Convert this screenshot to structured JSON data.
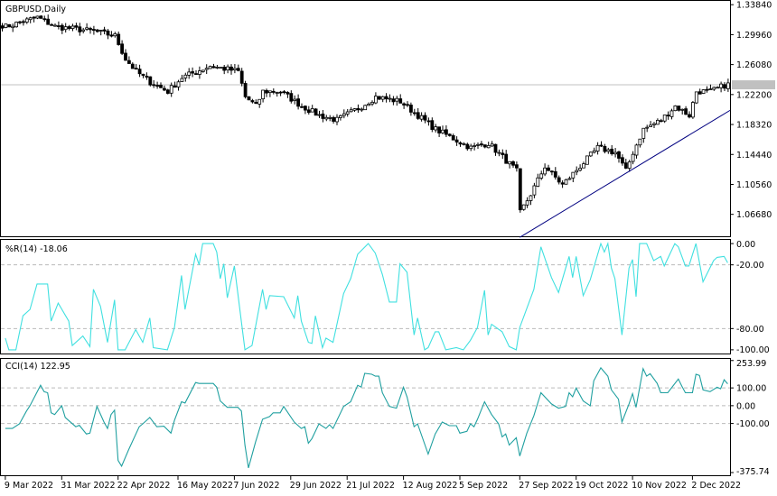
{
  "chart_data": [
    {
      "type": "candlestick",
      "title": "GBPUSD,Daily",
      "bar_count": 207,
      "y_ticks": [
        "1.33840",
        "1.29960",
        "1.26080",
        "1.22200",
        "1.18320",
        "1.14440",
        "1.10560",
        "1.06680"
      ],
      "ylim": [
        1.0384,
        1.3433
      ],
      "current_price_line": 1.2346,
      "close_anchors": [
        [
          0,
          1.312
        ],
        [
          1,
          1.31
        ],
        [
          10,
          1.322
        ],
        [
          15,
          1.31
        ],
        [
          26,
          1.304
        ],
        [
          32,
          1.298
        ],
        [
          35,
          1.268
        ],
        [
          38,
          1.252
        ],
        [
          42,
          1.238
        ],
        [
          47,
          1.226
        ],
        [
          51,
          1.244
        ],
        [
          59,
          1.259
        ],
        [
          67,
          1.252
        ],
        [
          69,
          1.219
        ],
        [
          72,
          1.207
        ],
        [
          74,
          1.226
        ],
        [
          79,
          1.226
        ],
        [
          85,
          1.207
        ],
        [
          90,
          1.195
        ],
        [
          95,
          1.189
        ],
        [
          101,
          1.204
        ],
        [
          106,
          1.219
        ],
        [
          113,
          1.213
        ],
        [
          118,
          1.195
        ],
        [
          123,
          1.177
        ],
        [
          128,
          1.165
        ],
        [
          133,
          1.153
        ],
        [
          138,
          1.159
        ],
        [
          142,
          1.141
        ],
        [
          146,
          1.123
        ],
        [
          147,
          1.069
        ],
        [
          150,
          1.093
        ],
        [
          154,
          1.129
        ],
        [
          159,
          1.105
        ],
        [
          164,
          1.129
        ],
        [
          169,
          1.153
        ],
        [
          174,
          1.147
        ],
        [
          177,
          1.123
        ],
        [
          179,
          1.147
        ],
        [
          182,
          1.177
        ],
        [
          187,
          1.189
        ],
        [
          191,
          1.207
        ],
        [
          195,
          1.195
        ],
        [
          197,
          1.226
        ],
        [
          201,
          1.226
        ],
        [
          205,
          1.234
        ],
        [
          206,
          1.235
        ]
      ],
      "trendline": [
        [
          147,
          1.037
        ],
        [
          207,
          1.2015
        ]
      ],
      "colors": {
        "candle": "#000000",
        "trendline": "#000080",
        "price_line": "#c0c0c0"
      }
    },
    {
      "type": "line",
      "title": "%R(14) -18.06",
      "ylim": [
        -100,
        0
      ],
      "y_ticks": [
        "0.00",
        "-20.00",
        "-80.00",
        "-100.00"
      ],
      "levels": [
        -20,
        -80
      ],
      "color": "#40e0e0",
      "points": [
        [
          1,
          -89
        ],
        [
          2,
          -100
        ],
        [
          4,
          -100
        ],
        [
          6,
          -68
        ],
        [
          8,
          -62
        ],
        [
          10,
          -38
        ],
        [
          13,
          -38
        ],
        [
          14,
          -73
        ],
        [
          16,
          -56
        ],
        [
          19,
          -73
        ],
        [
          20,
          -96
        ],
        [
          23,
          -87
        ],
        [
          25,
          -97
        ],
        [
          26,
          -43
        ],
        [
          28,
          -59
        ],
        [
          30,
          -93
        ],
        [
          32,
          -53
        ],
        [
          33,
          -100
        ],
        [
          35,
          -100
        ],
        [
          38,
          -81
        ],
        [
          40,
          -93
        ],
        [
          42,
          -70
        ],
        [
          43,
          -98
        ],
        [
          47,
          -100
        ],
        [
          49,
          -79
        ],
        [
          51,
          -30
        ],
        [
          52,
          -62
        ],
        [
          55,
          -10
        ],
        [
          56,
          -20
        ],
        [
          57,
          0
        ],
        [
          60,
          0
        ],
        [
          61,
          -8
        ],
        [
          62,
          -33
        ],
        [
          63,
          -19
        ],
        [
          64,
          -51
        ],
        [
          66,
          -21
        ],
        [
          69,
          -100
        ],
        [
          71,
          -96
        ],
        [
          74,
          -43
        ],
        [
          75,
          -62
        ],
        [
          76,
          -49
        ],
        [
          80,
          -50
        ],
        [
          83,
          -70
        ],
        [
          84,
          -49
        ],
        [
          85,
          -73
        ],
        [
          87,
          -93
        ],
        [
          88,
          -94
        ],
        [
          89,
          -68
        ],
        [
          91,
          -98
        ],
        [
          92,
          -89
        ],
        [
          94,
          -93
        ],
        [
          97,
          -47
        ],
        [
          99,
          -33
        ],
        [
          101,
          -10
        ],
        [
          104,
          0
        ],
        [
          106,
          -9
        ],
        [
          108,
          -29
        ],
        [
          110,
          -55
        ],
        [
          112,
          -55
        ],
        [
          113,
          -19
        ],
        [
          115,
          -27
        ],
        [
          117,
          -86
        ],
        [
          118,
          -70
        ],
        [
          120,
          -100
        ],
        [
          121,
          -98
        ],
        [
          123,
          -83
        ],
        [
          124,
          -83
        ],
        [
          126,
          -100
        ],
        [
          129,
          -98
        ],
        [
          131,
          -100
        ],
        [
          133,
          -91
        ],
        [
          135,
          -79
        ],
        [
          137,
          -44
        ],
        [
          138,
          -86
        ],
        [
          139,
          -76
        ],
        [
          142,
          -83
        ],
        [
          144,
          -97
        ],
        [
          146,
          -100
        ],
        [
          147,
          -79
        ],
        [
          151,
          -43
        ],
        [
          153,
          -3
        ],
        [
          156,
          -32
        ],
        [
          158,
          -46
        ],
        [
          161,
          -12
        ],
        [
          162,
          -32
        ],
        [
          163,
          -12
        ],
        [
          165,
          -49
        ],
        [
          167,
          -34
        ],
        [
          170,
          0
        ],
        [
          171,
          -8
        ],
        [
          172,
          0
        ],
        [
          173,
          -23
        ],
        [
          174,
          -33
        ],
        [
          176,
          -86
        ],
        [
          178,
          -23
        ],
        [
          179,
          -15
        ],
        [
          180,
          -50
        ],
        [
          181,
          0
        ],
        [
          183,
          0
        ],
        [
          185,
          -16
        ],
        [
          187,
          -12
        ],
        [
          188,
          -21
        ],
        [
          191,
          0
        ],
        [
          192,
          -3
        ],
        [
          194,
          -21
        ],
        [
          195,
          -21
        ],
        [
          197,
          0
        ],
        [
          199,
          -36
        ],
        [
          202,
          -16
        ],
        [
          203,
          -13
        ],
        [
          205,
          -12
        ],
        [
          206,
          -18.06
        ]
      ]
    },
    {
      "type": "line",
      "title": "CCI(14) 122.95",
      "ylim": [
        -375.74,
        253.99
      ],
      "y_ticks": [
        "253.99",
        "100.00",
        "0.00",
        "-100.00",
        "-375.74"
      ],
      "levels": [
        100,
        0,
        -100
      ],
      "color": "#20a0a0",
      "points": [
        [
          1,
          -128
        ],
        [
          3,
          -128
        ],
        [
          5,
          -102
        ],
        [
          7,
          -30
        ],
        [
          8,
          0
        ],
        [
          11,
          115
        ],
        [
          12,
          79
        ],
        [
          13,
          73
        ],
        [
          14,
          -40
        ],
        [
          15,
          -50
        ],
        [
          17,
          0
        ],
        [
          18,
          -66
        ],
        [
          21,
          -118
        ],
        [
          22,
          -110
        ],
        [
          24,
          -159
        ],
        [
          25,
          -154
        ],
        [
          27,
          -4
        ],
        [
          29,
          -92
        ],
        [
          30,
          -128
        ],
        [
          31,
          -50
        ],
        [
          32,
          -25
        ],
        [
          33,
          -308
        ],
        [
          34,
          -340
        ],
        [
          36,
          -247
        ],
        [
          39,
          -118
        ],
        [
          40,
          -102
        ],
        [
          42,
          -66
        ],
        [
          44,
          -118
        ],
        [
          46,
          -115
        ],
        [
          48,
          -154
        ],
        [
          49,
          -82
        ],
        [
          51,
          22
        ],
        [
          52,
          15
        ],
        [
          55,
          130
        ],
        [
          56,
          125
        ],
        [
          60,
          125
        ],
        [
          61,
          104
        ],
        [
          62,
          27
        ],
        [
          64,
          -9
        ],
        [
          67,
          -9
        ],
        [
          68,
          -30
        ],
        [
          69,
          -221
        ],
        [
          70,
          -350
        ],
        [
          72,
          -205
        ],
        [
          74,
          -76
        ],
        [
          76,
          -61
        ],
        [
          77,
          -40
        ],
        [
          79,
          -40
        ],
        [
          80,
          -4
        ],
        [
          83,
          -92
        ],
        [
          85,
          -128
        ],
        [
          86,
          -118
        ],
        [
          87,
          -211
        ],
        [
          88,
          -185
        ],
        [
          90,
          -102
        ],
        [
          92,
          -128
        ],
        [
          93,
          -107
        ],
        [
          94,
          -128
        ],
        [
          97,
          -4
        ],
        [
          99,
          22
        ],
        [
          101,
          115
        ],
        [
          102,
          105
        ],
        [
          103,
          182
        ],
        [
          105,
          177
        ],
        [
          106,
          166
        ],
        [
          107,
          166
        ],
        [
          108,
          73
        ],
        [
          110,
          -4
        ],
        [
          112,
          -14
        ],
        [
          114,
          104
        ],
        [
          115,
          50
        ],
        [
          117,
          -118
        ],
        [
          118,
          -102
        ],
        [
          121,
          -272
        ],
        [
          123,
          -159
        ],
        [
          125,
          -92
        ],
        [
          127,
          -112
        ],
        [
          129,
          -112
        ],
        [
          130,
          -154
        ],
        [
          132,
          -144
        ],
        [
          133,
          -102
        ],
        [
          134,
          -118
        ],
        [
          135,
          -76
        ],
        [
          137,
          22
        ],
        [
          139,
          -50
        ],
        [
          141,
          -102
        ],
        [
          142,
          -175
        ],
        [
          143,
          -159
        ],
        [
          144,
          -221
        ],
        [
          146,
          -180
        ],
        [
          147,
          -283
        ],
        [
          149,
          -154
        ],
        [
          151,
          -56
        ],
        [
          153,
          73
        ],
        [
          156,
          10
        ],
        [
          158,
          -14
        ],
        [
          160,
          -4
        ],
        [
          161,
          73
        ],
        [
          162,
          50
        ],
        [
          163,
          99
        ],
        [
          165,
          27
        ],
        [
          167,
          0
        ],
        [
          168,
          140
        ],
        [
          170,
          213
        ],
        [
          172,
          166
        ],
        [
          173,
          89
        ],
        [
          175,
          37
        ],
        [
          176,
          -92
        ],
        [
          178,
          10
        ],
        [
          179,
          68
        ],
        [
          180,
          -9
        ],
        [
          182,
          208
        ],
        [
          183,
          166
        ],
        [
          184,
          180
        ],
        [
          186,
          125
        ],
        [
          187,
          73
        ],
        [
          189,
          73
        ],
        [
          192,
          150
        ],
        [
          193,
          110
        ],
        [
          194,
          73
        ],
        [
          196,
          73
        ],
        [
          197,
          177
        ],
        [
          198,
          170
        ],
        [
          199,
          89
        ],
        [
          201,
          79
        ],
        [
          203,
          104
        ],
        [
          204,
          95
        ],
        [
          205,
          146
        ],
        [
          206,
          122.95
        ]
      ]
    }
  ],
  "x_axis": {
    "labels": [
      "9 Mar 2022",
      "31 Mar 2022",
      "22 Apr 2022",
      "16 May 2022",
      "7 Jun 2022",
      "29 Jun 2022",
      "21 Jul 2022",
      "12 Aug 2022",
      "5 Sep 2022",
      "27 Sep 2022",
      "19 Oct 2022",
      "10 Nov 2022",
      "2 Dec 2022"
    ],
    "label_bars": [
      1,
      17,
      33,
      50,
      66,
      82,
      98,
      114,
      130,
      147,
      163,
      179,
      196
    ]
  }
}
